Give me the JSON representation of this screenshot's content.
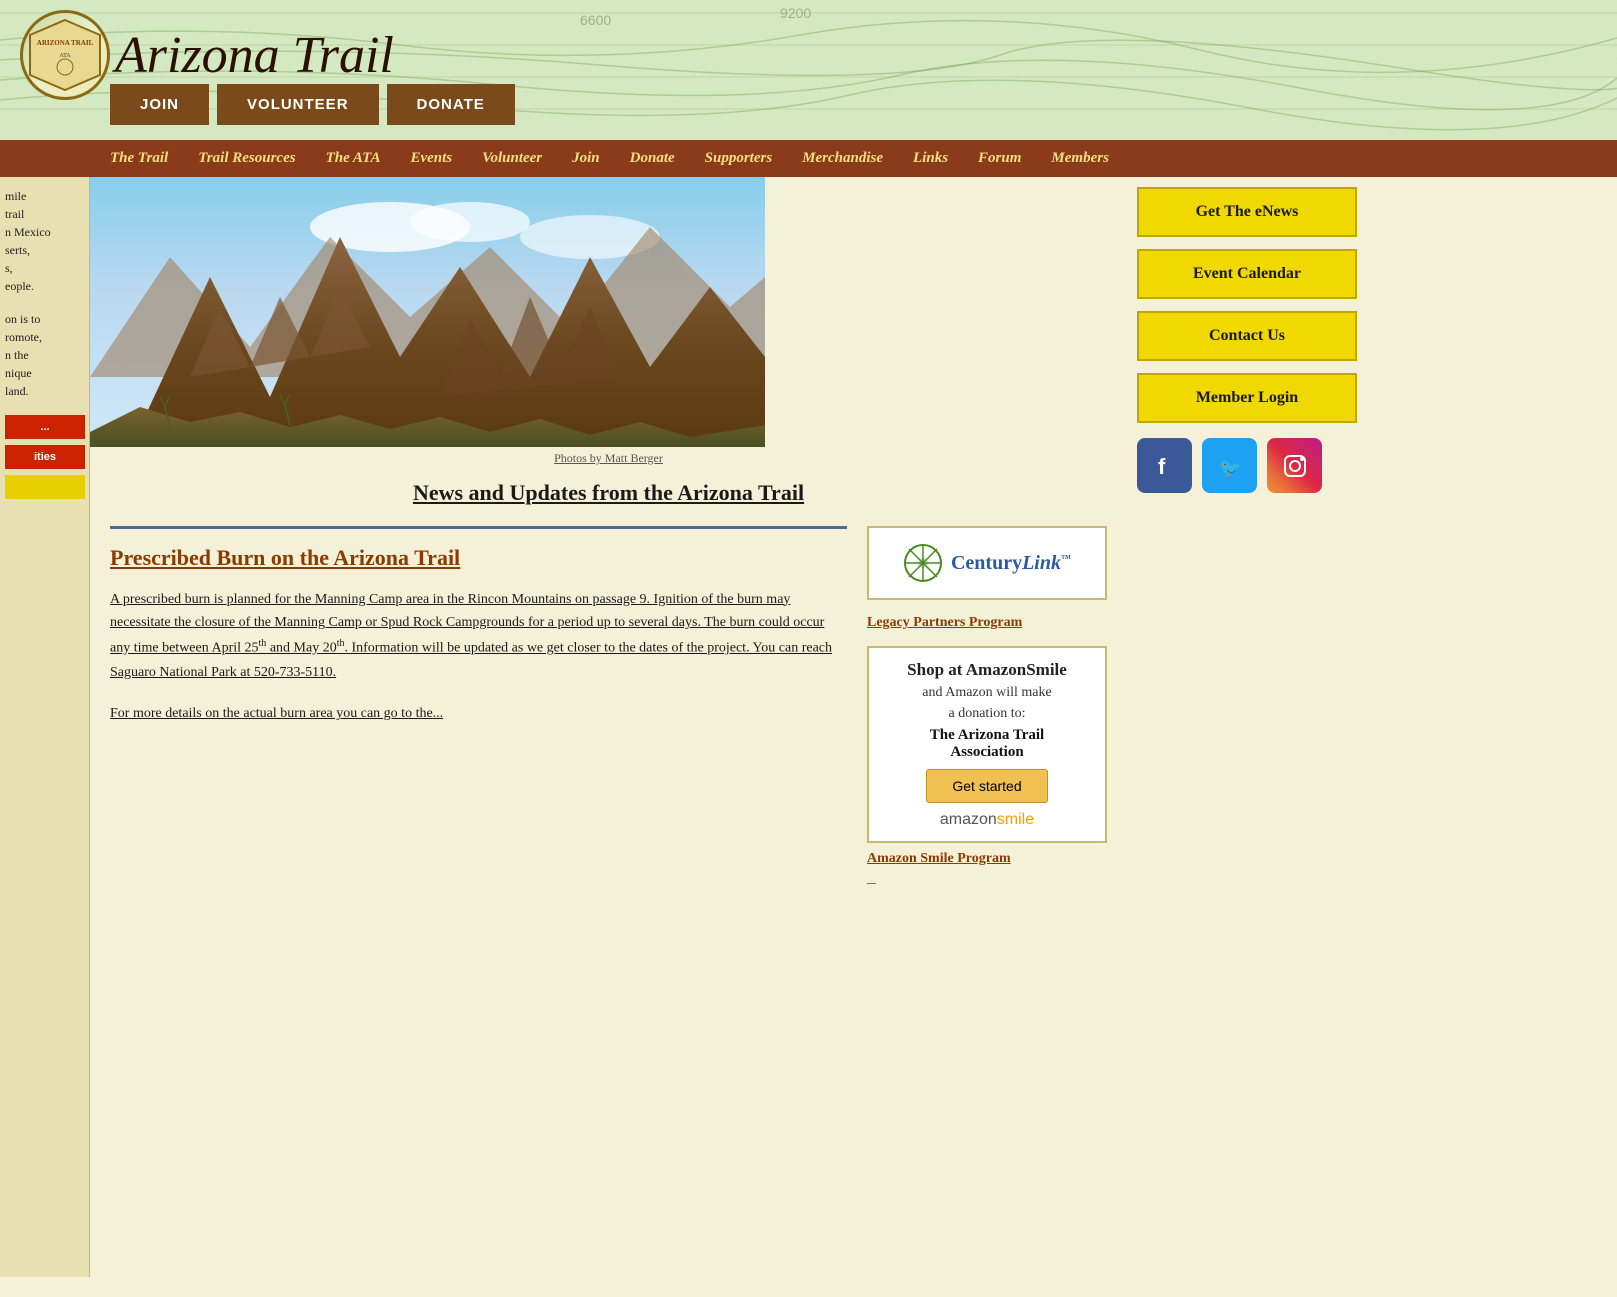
{
  "header": {
    "logo_text": "Arizona Trail",
    "buttons": {
      "join": "JOIN",
      "volunteer": "VOLUNTEER",
      "donate": "DONATE"
    }
  },
  "nav": {
    "items": [
      {
        "label": "The Trail",
        "id": "the-trail"
      },
      {
        "label": "Trail Resources",
        "id": "trail-resources"
      },
      {
        "label": "The ATA",
        "id": "the-ata"
      },
      {
        "label": "Events",
        "id": "events"
      },
      {
        "label": "Volunteer",
        "id": "volunteer"
      },
      {
        "label": "Join",
        "id": "join"
      },
      {
        "label": "Donate",
        "id": "donate"
      },
      {
        "label": "Supporters",
        "id": "supporters"
      },
      {
        "label": "Merchandise",
        "id": "merchandise"
      },
      {
        "label": "Links",
        "id": "links"
      },
      {
        "label": "Forum",
        "id": "forum"
      },
      {
        "label": "Members",
        "id": "members"
      }
    ]
  },
  "sidebar": {
    "description_lines": [
      "mile",
      "trail",
      "n Mexico",
      "serts,",
      "s,",
      "eople."
    ],
    "mission_lines": [
      "on is to",
      "romote,",
      "n the",
      "nique",
      "land."
    ],
    "buttons": [
      {
        "label": "...",
        "style": "red"
      },
      {
        "label": "ities",
        "style": "red"
      },
      {
        "label": "",
        "style": "yellow"
      }
    ]
  },
  "hero": {
    "photo_credit": "Photos by Matt Berger",
    "alt": "Arizona Trail mountain landscape"
  },
  "news": {
    "title": "News and Updates from the Arizona Trail",
    "article": {
      "title": "Prescribed Burn on the Arizona Trail",
      "body_parts": [
        "A prescribed burn is planned for the Manning Camp area in the Rincon Mountains on passage 9. Ignition of the burn may necessitate the closure of the Manning Camp or Spud Rock Campgrounds for a period up to several days. The burn could occur any time between April 25",
        "th",
        " and May 20",
        "th",
        ". Information will be updated as we get closer to the dates of the project. You can reach Saguaro National Park at 520-733-5110.",
        "\n\nFor more details on the actual burn area you can go to the..."
      ]
    }
  },
  "right_sidebar": {
    "buttons": [
      {
        "label": "Get The eNews",
        "id": "get-enews"
      },
      {
        "label": "Event Calendar",
        "id": "event-calendar"
      },
      {
        "label": "Contact Us",
        "id": "contact-us"
      },
      {
        "label": "Member Login",
        "id": "member-login"
      }
    ],
    "social": {
      "facebook": "f",
      "twitter": "t",
      "instagram": "📷"
    }
  },
  "ads": {
    "centurylink": {
      "name": "CenturyLink",
      "tagline": "Legacy Partners Program"
    },
    "amazon": {
      "line1": "Shop at AmazonSmile",
      "line2": "and Amazon will make",
      "line3": "a donation to:",
      "org": "The Arizona Trail Association",
      "btn": "Get started",
      "brand": "amazonsmile",
      "link": "Amazon Smile Program"
    }
  }
}
